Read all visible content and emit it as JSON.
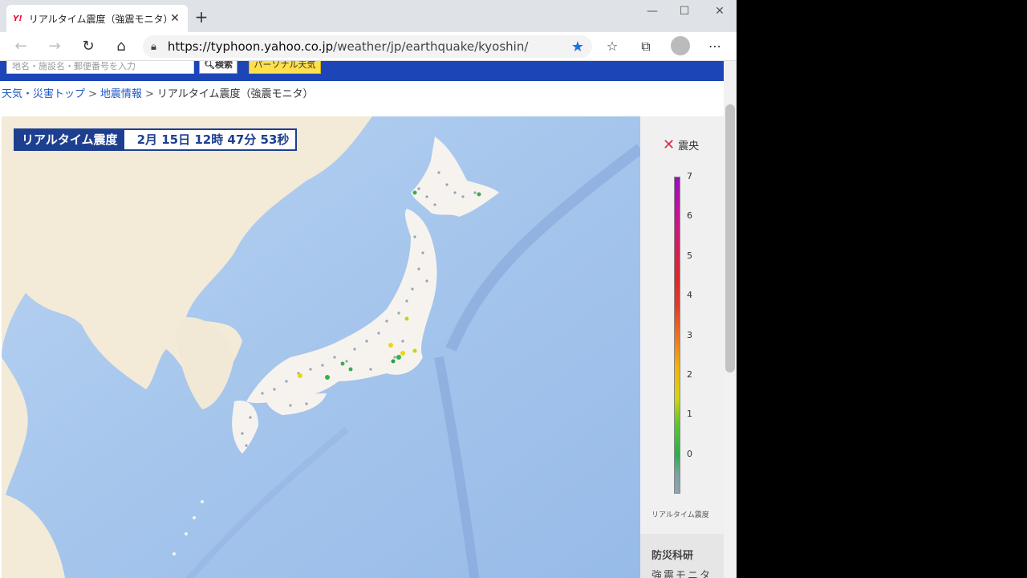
{
  "browser": {
    "tab_title": "リアルタイム震度（強震モニタ） - Y",
    "url_host": "https://typhoon.yahoo.co.jp",
    "url_path": "/weather/jp/earthquake/kyoshin/"
  },
  "header": {
    "search_placeholder": "地名・施設名・郵便番号を入力",
    "search_button": "検索",
    "personal_button": "パーソナル天気"
  },
  "breadcrumb": {
    "item1": "天気・災害トップ",
    "item2": "地震情報",
    "current": "リアルタイム震度（強震モニタ）"
  },
  "map": {
    "label": "リアルタイム震度",
    "timestamp": "2月 15日 12時 47分 53秒"
  },
  "legend": {
    "epicenter_label": "震央",
    "ticks": [
      "7",
      "6",
      "5",
      "4",
      "3",
      "2",
      "1",
      "0"
    ],
    "scale_label": "リアルタイム震度",
    "provider1": "防災科研",
    "provider2": "強震モニタ"
  },
  "colors": {
    "header_blue": "#1c46b7",
    "sea": "#a8c7ec",
    "land": "#f3ead9",
    "japan": "#f6f3ee"
  }
}
